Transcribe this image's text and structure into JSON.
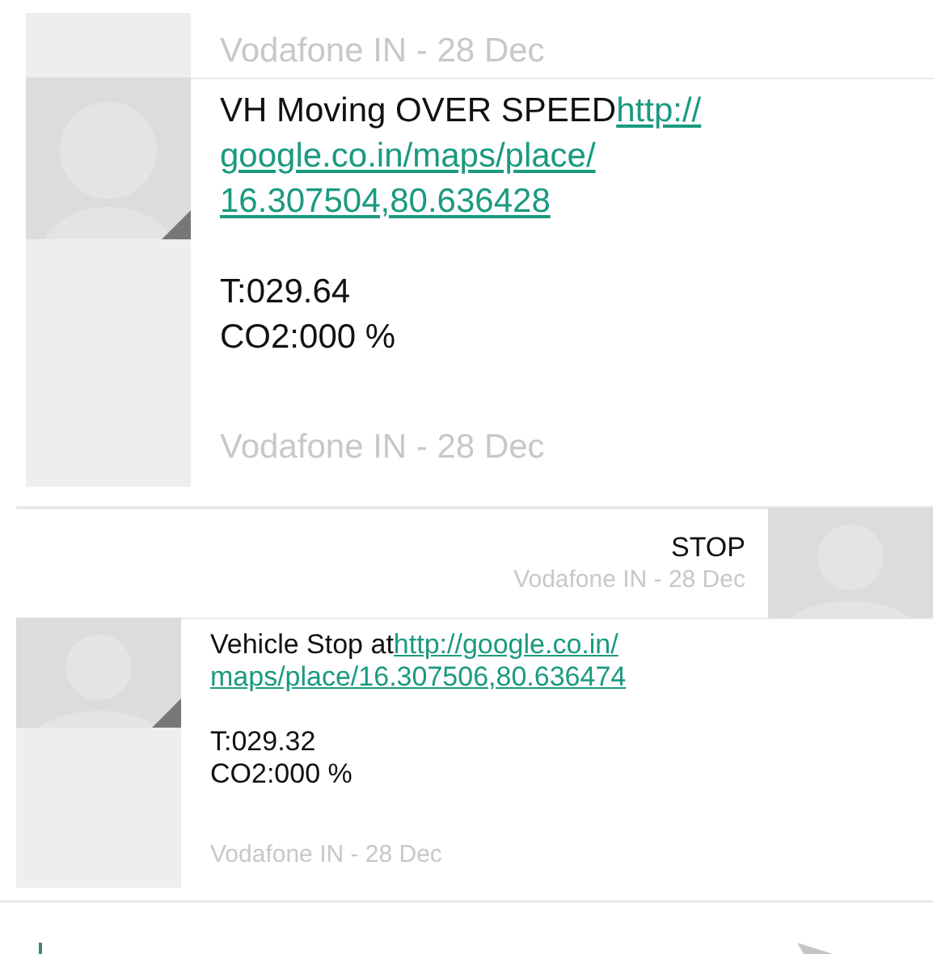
{
  "messages": [
    {
      "kind": "incoming",
      "time": "Vodafone IN - 28 Dec"
    },
    {
      "kind": "incoming",
      "text": "VH Moving OVER SPEED",
      "link_lines": [
        "http://",
        "google.co.in/maps/place/",
        "16.307504,80.636428"
      ],
      "lines": [
        "T:029.64",
        "CO2:000 %"
      ],
      "time": "Vodafone IN - 28 Dec"
    },
    {
      "kind": "outgoing",
      "text": "STOP",
      "time": "Vodafone IN - 28 Dec"
    },
    {
      "kind": "incoming",
      "text": "Vehicle Stop at",
      "link_lines": [
        "http://google.co.in/",
        "maps/place/16.307506,80.636474"
      ],
      "lines": [
        "T:029.32",
        "CO2:000 %"
      ],
      "time": "Vodafone IN - 28 Dec"
    }
  ]
}
